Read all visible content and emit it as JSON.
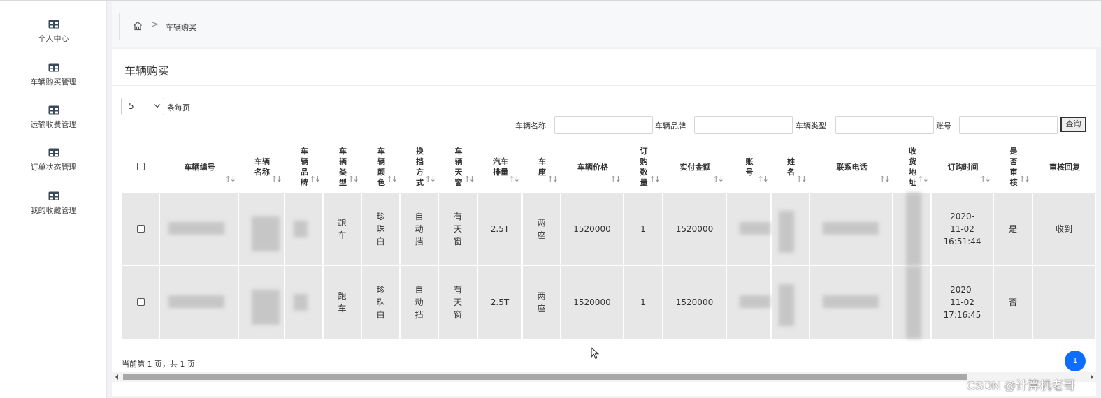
{
  "sidebar": {
    "items": [
      {
        "label": "个人中心",
        "icon": "table-icon"
      },
      {
        "label": "车辆购买管理",
        "icon": "table-icon"
      },
      {
        "label": "运输收费管理",
        "icon": "table-icon"
      },
      {
        "label": "订单状态管理",
        "icon": "table-icon"
      },
      {
        "label": "我的收藏管理",
        "icon": "table-icon"
      }
    ]
  },
  "breadcrumb": {
    "separator": ">",
    "current": "车辆购买"
  },
  "page": {
    "title": "车辆购买"
  },
  "page_size": {
    "value": "5",
    "label": "条每页"
  },
  "filters": {
    "name_label": "车辆名称",
    "brand_label": "车辆品牌",
    "type_label": "车辆类型",
    "account_label": "账号",
    "search_button": "查询"
  },
  "table": {
    "sort_glyph": "↑↓",
    "columns": [
      {
        "label": "",
        "checkbox": true
      },
      {
        "label": "车辆编号"
      },
      {
        "label": "车辆\n名称"
      },
      {
        "label": "车\n辆\n品\n牌"
      },
      {
        "label": "车\n辆\n类\n型"
      },
      {
        "label": "车\n辆\n颜\n色"
      },
      {
        "label": "换\n挡\n方\n式"
      },
      {
        "label": "车\n辆\n天\n窗"
      },
      {
        "label": "汽车\n排量"
      },
      {
        "label": "车\n座"
      },
      {
        "label": "车辆价格"
      },
      {
        "label": "订\n购\n数\n量"
      },
      {
        "label": "实付金额"
      },
      {
        "label": "账\n号"
      },
      {
        "label": "姓\n名"
      },
      {
        "label": "联系电话"
      },
      {
        "label": "收\n货\n地\n址"
      },
      {
        "label": "订购时间"
      },
      {
        "label": "是\n否\n审\n核"
      },
      {
        "label": "审核回复"
      }
    ],
    "rows": [
      {
        "type": "跑\n车",
        "color": "珍\n珠\n白",
        "shift": "自\n动\n挡",
        "roof": "有\n天\n窗",
        "displacement": "2.5T",
        "seats": "两\n座",
        "price": "1520000",
        "qty": "1",
        "paid": "1520000",
        "time": "2020-\n11-02\n16:51:44",
        "audited": "是",
        "reply": "收到"
      },
      {
        "type": "跑\n车",
        "color": "珍\n珠\n白",
        "shift": "自\n动\n挡",
        "roof": "有\n天\n窗",
        "displacement": "2.5T",
        "seats": "两\n座",
        "price": "1520000",
        "qty": "1",
        "paid": "1520000",
        "time": "2020-\n11-02\n17:16:45",
        "audited": "否",
        "reply": ""
      }
    ]
  },
  "pager": {
    "text": "当前第 1 页，共 1 页",
    "current": "1"
  },
  "watermark": "CSDN @计算机老哥",
  "colors": {
    "accent": "#0d6efd",
    "cell_bg": "#e7e7e7"
  }
}
